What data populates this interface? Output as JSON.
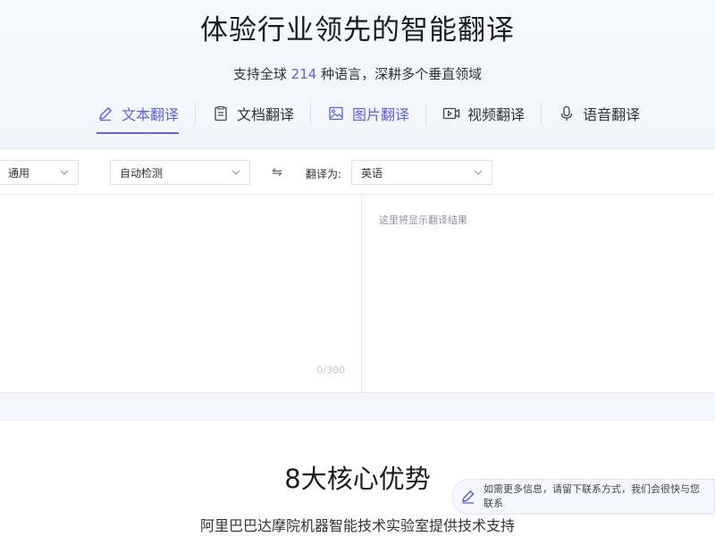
{
  "hero": {
    "title": "体验行业领先的智能翻译",
    "subtitle_prefix": "支持全球 ",
    "subtitle_count": "214",
    "subtitle_suffix": " 种语言，深耕多个垂直领域"
  },
  "tabs": [
    {
      "label": "文本翻译",
      "icon": "pen-icon",
      "active": true
    },
    {
      "label": "文档翻译",
      "icon": "document-icon",
      "active": false
    },
    {
      "label": "图片翻译",
      "icon": "image-icon",
      "active": false
    },
    {
      "label": "视频翻译",
      "icon": "video-icon",
      "active": false
    },
    {
      "label": "语音翻译",
      "icon": "microphone-icon",
      "active": false
    }
  ],
  "toolbar": {
    "domain_value": "通用",
    "source_lang_value": "自动检测",
    "swap_glyph": "⇋",
    "target_label": "翻译为:",
    "target_lang_value": "英语"
  },
  "source": {
    "counter": "0/300"
  },
  "result": {
    "placeholder": "这里将显示翻译结果"
  },
  "advantages": {
    "title": "8大核心优势",
    "subtitle": "阿里巴巴达摩院机器智能技术实验室提供技术支持"
  },
  "contact": {
    "text": "如需更多信息，请留下联系方式，我们会很快与您联系"
  },
  "colors": {
    "accent": "#5a63d8"
  }
}
